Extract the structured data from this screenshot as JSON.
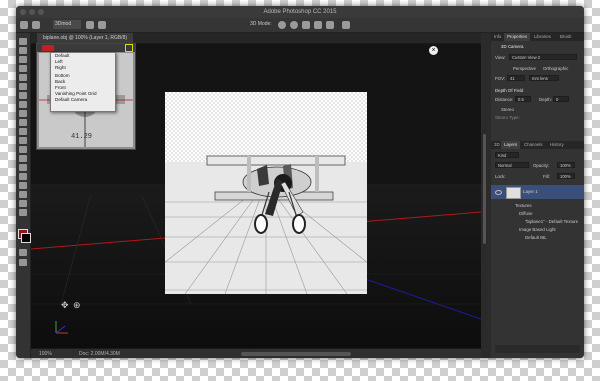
{
  "window": {
    "title": "Adobe Photoshop CC 2015"
  },
  "options_bar": {
    "preset": "3Dmod",
    "mode": "3D Mode:"
  },
  "document": {
    "tab_label": "biplane.obj @ 100% (Layer 1, RGB/8)"
  },
  "mini_view": {
    "coordinate_readout": "41.29",
    "menu_items": [
      "Default",
      "Left",
      "Right",
      "Bottom",
      "Back",
      "Front",
      "Vanishing Point Grid",
      "Default Camera"
    ]
  },
  "status_bar": {
    "zoom": "100%",
    "doc_size": "Doc: 2.00M/4.30M"
  },
  "properties_panel": {
    "tabs": [
      "Info",
      "Properties",
      "Libraries",
      "Brush"
    ],
    "header": "3D Camera",
    "view_label": "View:",
    "view_value": "Custom View 2",
    "perspective": "Perspective",
    "orthographic": "Orthographic",
    "fov_label": "FOV:",
    "fov_value": "41",
    "fov_unit": "mm lens",
    "dof_label": "Depth Of Field",
    "distance_label": "Distance:",
    "distance_value": "0.5",
    "depth_label": "Depth:",
    "depth_value": "0",
    "stereo_label": "Stereo",
    "stereo_type": "Stereo Type:"
  },
  "layers_panel": {
    "tabs": [
      "3D",
      "Layers",
      "Channels",
      "History"
    ],
    "kind": "Kind",
    "blend_mode": "Normal",
    "opacity_label": "Opacity:",
    "opacity_value": "100%",
    "lock_label": "Lock:",
    "fill_label": "Fill:",
    "fill_value": "100%",
    "layers": [
      "Layer 1",
      "Textures",
      "Diffuse",
      "\"biplane1\" - Default Texture",
      "Image Based Light",
      "Default IBL"
    ]
  },
  "colors": {
    "accent_red": "#c02020",
    "selection_blue": "#3a4f7a",
    "highlight_yellow": "#d7e000"
  }
}
